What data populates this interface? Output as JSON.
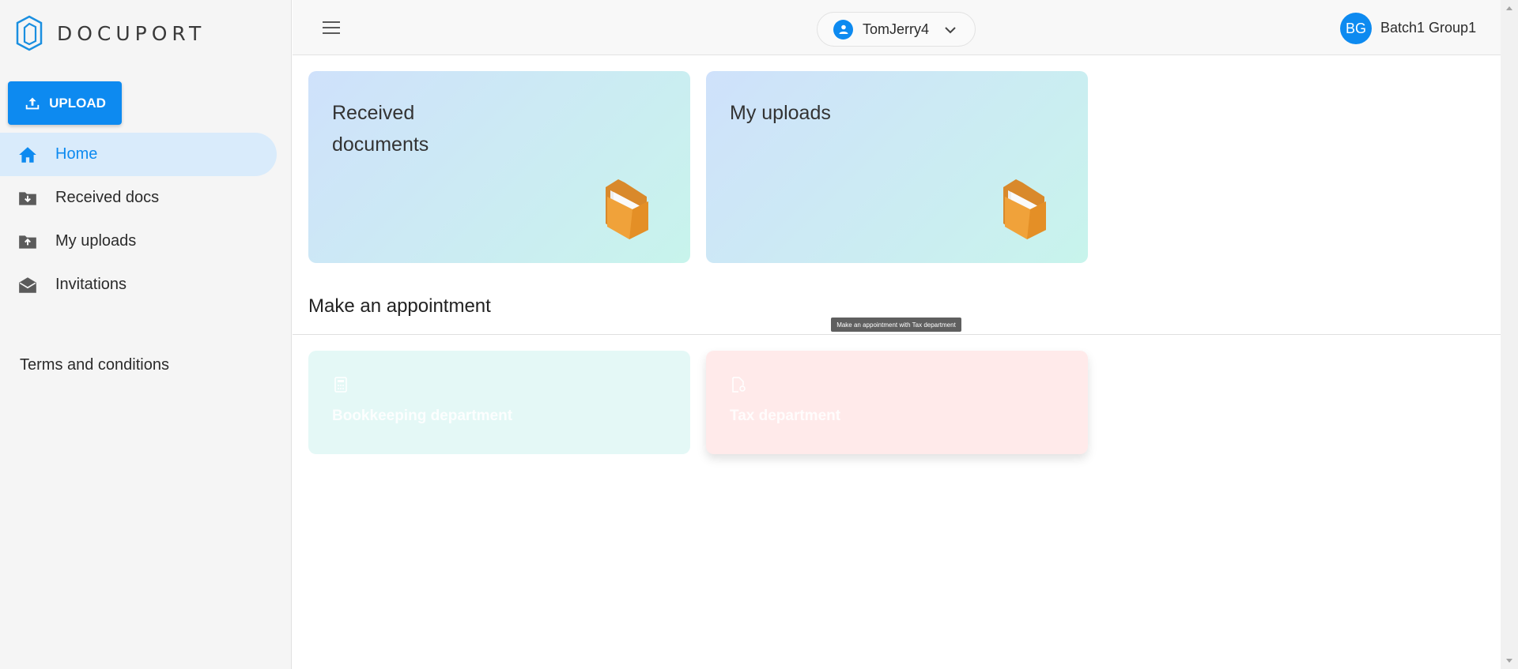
{
  "brand": {
    "name": "DOCUPORT",
    "accent": "#0d8af0"
  },
  "sidebar": {
    "upload_label": "UPLOAD",
    "items": [
      {
        "label": "Home",
        "icon": "home-icon",
        "active": true
      },
      {
        "label": "Received docs",
        "icon": "folder-download-icon"
      },
      {
        "label": "My uploads",
        "icon": "folder-upload-icon"
      },
      {
        "label": "Invitations",
        "icon": "envelope-open-icon"
      }
    ],
    "terms_label": "Terms and conditions"
  },
  "header": {
    "account": "TomJerry4",
    "avatar_initials": "BG",
    "profile_name": "Batch1 Group1"
  },
  "main": {
    "cards": [
      {
        "title": "Received documents",
        "icon": "folder-icon"
      },
      {
        "title": "My uploads",
        "icon": "folder-icon"
      }
    ],
    "appointment_title": "Make an appointment",
    "tooltip": "Make an appointment with Tax department",
    "departments": [
      {
        "name": "Bookkeeping department",
        "icon": "calculator-icon"
      },
      {
        "name": "Tax department",
        "icon": "file-settings-icon"
      }
    ]
  }
}
